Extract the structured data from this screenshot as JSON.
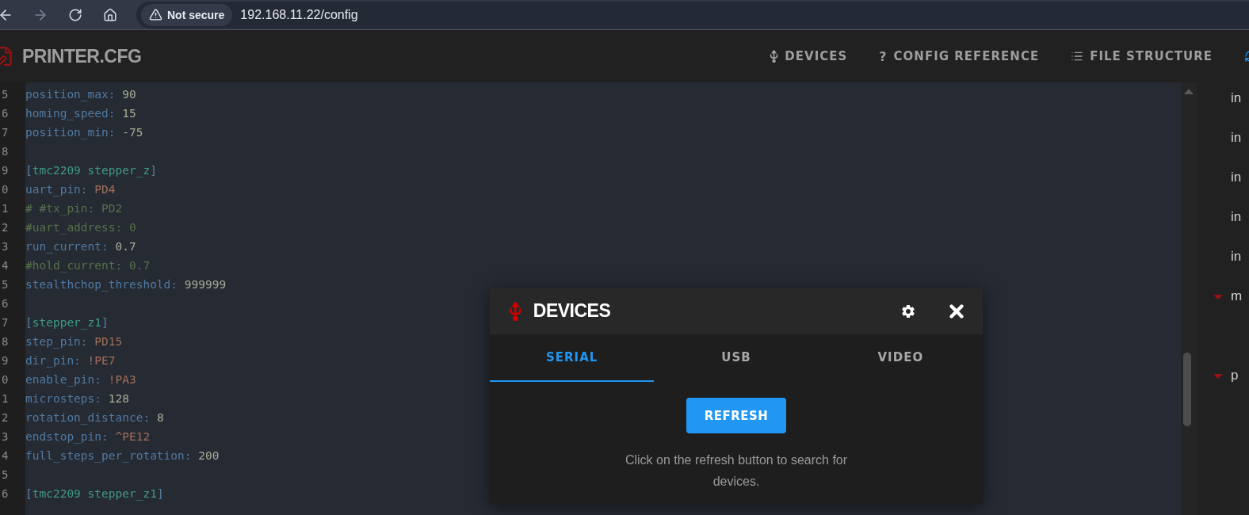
{
  "browser": {
    "security_label": "Not secure",
    "url": "192.168.11.22/config"
  },
  "header": {
    "title": "PRINTER.CFG",
    "nav": [
      {
        "label": "DEVICES",
        "kind": "usb"
      },
      {
        "label": "CONFIG REFERENCE",
        "glyph": "?"
      },
      {
        "label": "FILE STRUCTURE",
        "kind": "list"
      }
    ]
  },
  "editor": {
    "lines": [
      {
        "num": "5",
        "kind": "number",
        "key": "position_max:",
        "value": "90"
      },
      {
        "num": "6",
        "kind": "number",
        "key": "homing_speed:",
        "value": "15"
      },
      {
        "num": "7",
        "kind": "number",
        "key": "position_min:",
        "value": "-75"
      },
      {
        "num": "8",
        "kind": "blank"
      },
      {
        "num": "9",
        "kind": "section",
        "open": "[",
        "name": "tmc2209 stepper_z",
        "close": "]"
      },
      {
        "num": "0",
        "kind": "pin",
        "key": "uart_pin:",
        "value": "PD4"
      },
      {
        "num": "1",
        "kind": "comment",
        "text": "# #tx_pin: PD2"
      },
      {
        "num": "2",
        "kind": "comment",
        "text": "#uart_address: 0"
      },
      {
        "num": "3",
        "kind": "number",
        "key": "run_current:",
        "value": "0.7"
      },
      {
        "num": "4",
        "kind": "comment",
        "text": "#hold_current: 0.7"
      },
      {
        "num": "5",
        "kind": "number",
        "key": "stealthchop_threshold:",
        "value": "999999"
      },
      {
        "num": "6",
        "kind": "blank"
      },
      {
        "num": "7",
        "kind": "section",
        "open": "[",
        "name": "stepper_z1",
        "close": "]"
      },
      {
        "num": "8",
        "kind": "pin",
        "key": "step_pin:",
        "value": "PD15"
      },
      {
        "num": "9",
        "kind": "pin",
        "key": "dir_pin:",
        "value": "!PE7"
      },
      {
        "num": "0",
        "kind": "pin",
        "key": "enable_pin:",
        "value": "!PA3"
      },
      {
        "num": "1",
        "kind": "number",
        "key": "microsteps:",
        "value": "128"
      },
      {
        "num": "2",
        "kind": "number",
        "key": "rotation_distance:",
        "value": "8"
      },
      {
        "num": "3",
        "kind": "pin",
        "key": "endstop_pin:",
        "value": "^PE12"
      },
      {
        "num": "4",
        "kind": "number",
        "key": "full_steps_per_rotation:",
        "value": "200"
      },
      {
        "num": "5",
        "kind": "blank"
      },
      {
        "num": "6",
        "kind": "section",
        "open": "[",
        "name": "tmc2209 stepper_z1",
        "close": "]"
      }
    ]
  },
  "sidebar": {
    "items": [
      {
        "label": "in",
        "kind": "leaf"
      },
      {
        "label": "in",
        "kind": "leaf"
      },
      {
        "label": "in",
        "kind": "leaf"
      },
      {
        "label": "in",
        "kind": "leaf"
      },
      {
        "label": "in",
        "kind": "leaf"
      },
      {
        "label": "m",
        "kind": "group",
        "expanded": true
      },
      {
        "label": "p",
        "kind": "group",
        "expanded": true
      }
    ]
  },
  "dialog": {
    "title": "DEVICES",
    "tabs": [
      {
        "label": "SERIAL",
        "selected": true
      },
      {
        "label": "USB",
        "selected": false
      },
      {
        "label": "VIDEO",
        "selected": false
      }
    ],
    "button": "REFRESH",
    "message": "Click on the refresh button to search for devices."
  }
}
